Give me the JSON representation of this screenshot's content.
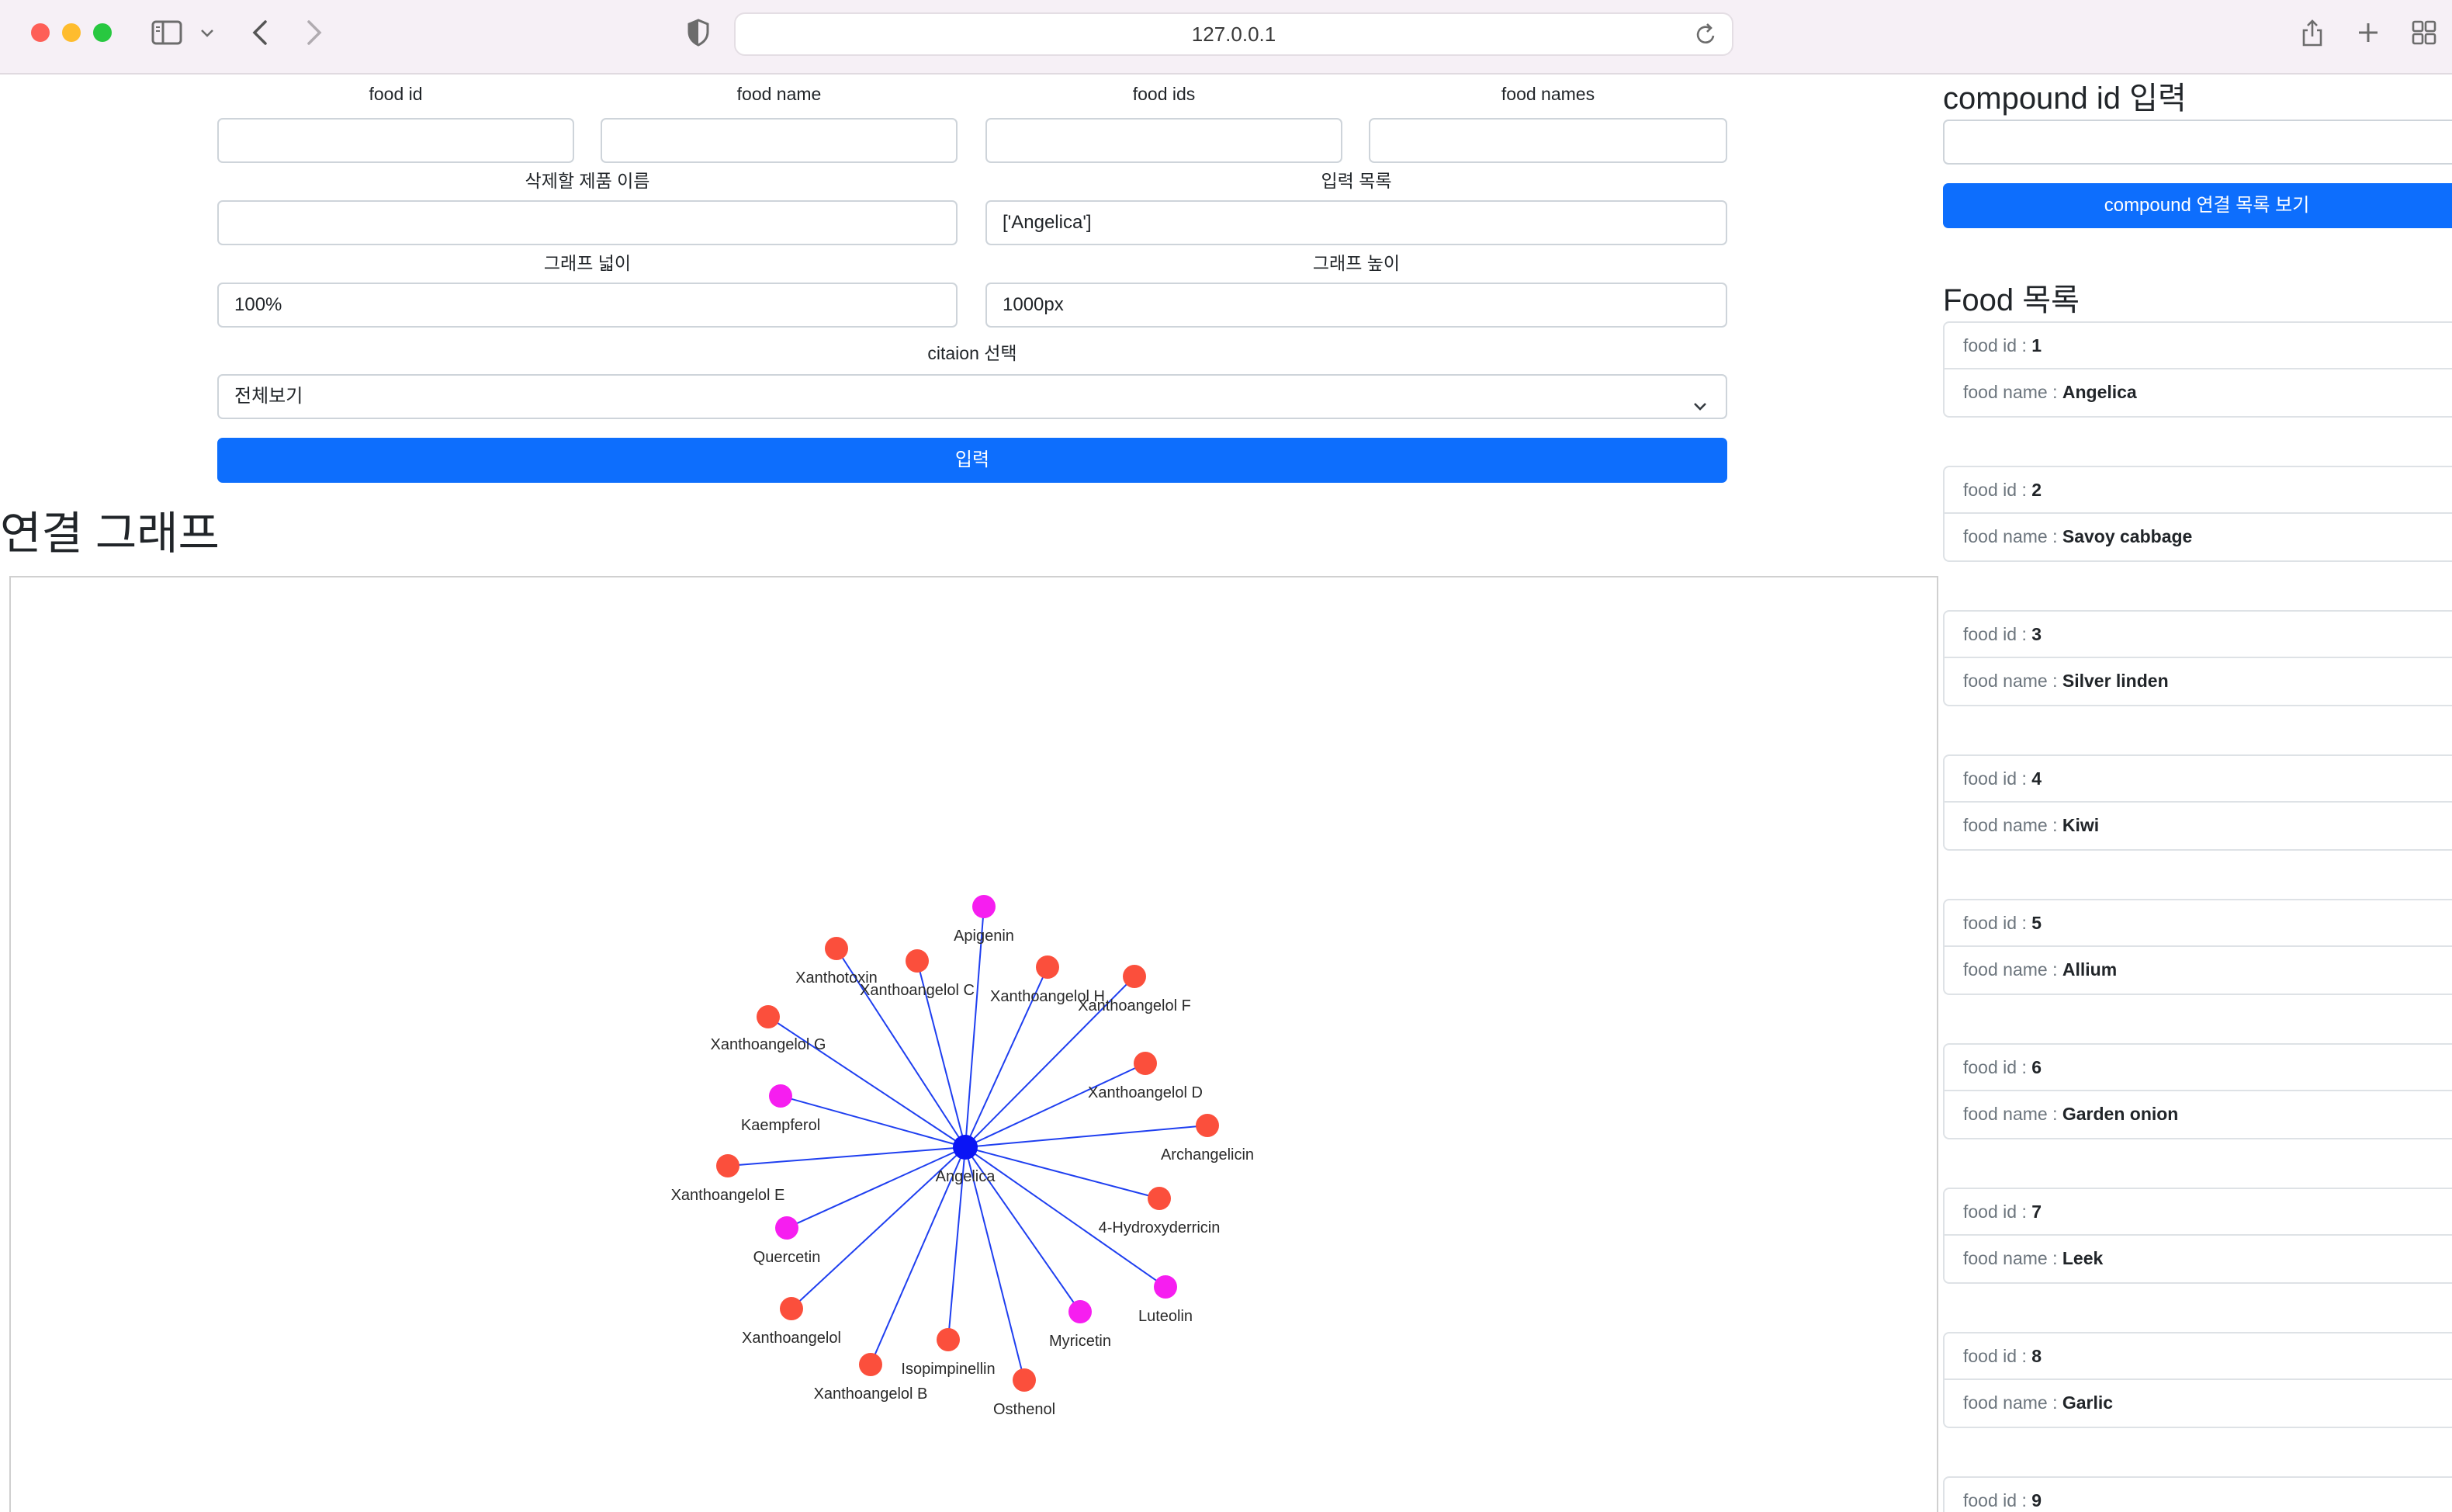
{
  "browser": {
    "url": "127.0.0.1",
    "icons": [
      "sidebar-icon",
      "chevron-down-icon",
      "back-icon",
      "forward-icon",
      "shield-icon",
      "reload-icon",
      "share-icon",
      "new-tab-icon",
      "tab-overview-icon"
    ]
  },
  "form": {
    "food_id_label": "food id",
    "food_name_label": "food name",
    "food_ids_label": "food ids",
    "food_names_label": "food names",
    "delete_name_label": "삭제할 제품 이름",
    "input_list_label": "입력 목록",
    "input_list_value": "['Angelica']",
    "graph_width_label": "그래프 넓이",
    "graph_width_value": "100%",
    "graph_height_label": "그래프 높이",
    "graph_height_value": "1000px",
    "citation_label": "citaion 선택",
    "citation_selected": "전체보기",
    "submit_label": "입력"
  },
  "graph": {
    "title": "연결 그래프",
    "colors": {
      "edge": "#1f3ff0",
      "center": "#0a14f5",
      "compound": "#fb4f3c",
      "flavonoid": "#f61ef0"
    },
    "center": {
      "label": "Angelica"
    },
    "nodes": [
      {
        "label": "Apigenin",
        "kind": "flavonoid"
      },
      {
        "label": "Xanthotoxin",
        "kind": "compound"
      },
      {
        "label": "Xanthoangelol C",
        "kind": "compound"
      },
      {
        "label": "Xanthoangelol H",
        "kind": "compound"
      },
      {
        "label": "Xanthoangelol F",
        "kind": "compound"
      },
      {
        "label": "Xanthoangelol G",
        "kind": "compound"
      },
      {
        "label": "Xanthoangelol D",
        "kind": "compound"
      },
      {
        "label": "Kaempferol",
        "kind": "flavonoid"
      },
      {
        "label": "Archangelicin",
        "kind": "compound"
      },
      {
        "label": "Xanthoangelol E",
        "kind": "compound"
      },
      {
        "label": "4-Hydroxyderricin",
        "kind": "compound"
      },
      {
        "label": "Quercetin",
        "kind": "flavonoid"
      },
      {
        "label": "Luteolin",
        "kind": "flavonoid"
      },
      {
        "label": "Xanthoangelol",
        "kind": "compound"
      },
      {
        "label": "Myricetin",
        "kind": "flavonoid"
      },
      {
        "label": "Isopimpinellin",
        "kind": "compound"
      },
      {
        "label": "Xanthoangelol B",
        "kind": "compound"
      },
      {
        "label": "Osthenol",
        "kind": "compound"
      }
    ]
  },
  "compound": {
    "title": "compound id 입력",
    "button_label": "compound 연결 목록 보기"
  },
  "food_list": {
    "title": "Food 목록",
    "id_key": "food id : ",
    "name_key": "food name : ",
    "items": [
      {
        "id": "1",
        "name": "Angelica"
      },
      {
        "id": "2",
        "name": "Savoy cabbage"
      },
      {
        "id": "3",
        "name": "Silver linden"
      },
      {
        "id": "4",
        "name": "Kiwi"
      },
      {
        "id": "5",
        "name": "Allium"
      },
      {
        "id": "6",
        "name": "Garden onion"
      },
      {
        "id": "7",
        "name": "Leek"
      },
      {
        "id": "8",
        "name": "Garlic"
      },
      {
        "id": "9",
        "name": ""
      }
    ]
  }
}
